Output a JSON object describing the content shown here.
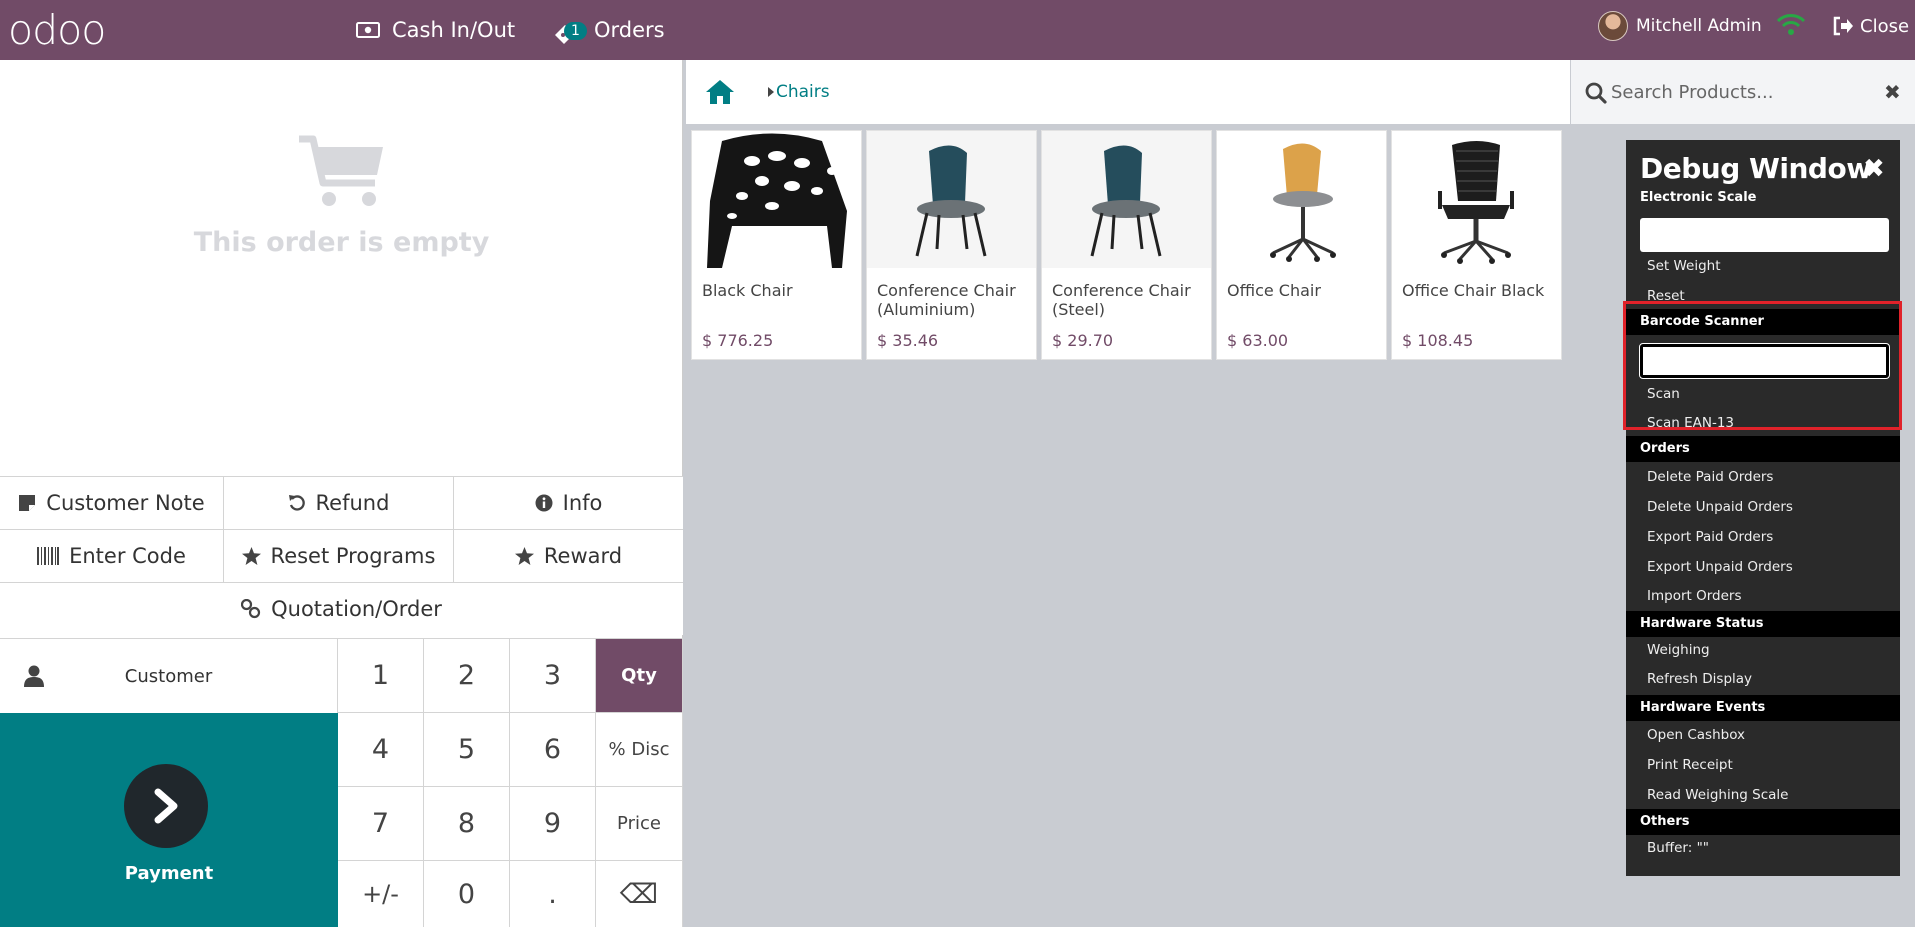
{
  "header": {
    "logo": "odoo",
    "cash_label": "Cash In/Out",
    "orders_label": "Orders",
    "orders_badge": "1",
    "user_name": "Mitchell Admin",
    "close_label": "Close"
  },
  "order": {
    "empty_text": "This order is empty"
  },
  "controls": {
    "customer_note": "Customer Note",
    "refund": "Refund",
    "info": "Info",
    "enter_code": "Enter Code",
    "reset_programs": "Reset Programs",
    "reward": "Reward",
    "quotation": "Quotation/Order"
  },
  "numpad": {
    "customer": "Customer",
    "payment": "Payment",
    "keys": [
      "1",
      "2",
      "3",
      "Qty",
      "4",
      "5",
      "6",
      "% Disc",
      "7",
      "8",
      "9",
      "Price",
      "+/-",
      "0",
      ".",
      "⌫"
    ]
  },
  "breadcrumb": {
    "category": "Chairs"
  },
  "search": {
    "placeholder": "Search Products..."
  },
  "products": [
    {
      "name": "Black Chair",
      "price": "$ 776.25"
    },
    {
      "name": "Conference Chair (Aluminium)",
      "price": "$ 35.46"
    },
    {
      "name": "Conference Chair (Steel)",
      "price": "$ 29.70"
    },
    {
      "name": "Office Chair",
      "price": "$ 63.00"
    },
    {
      "name": "Office Chair Black",
      "price": "$ 108.45"
    }
  ],
  "debug": {
    "title": "Debug Window",
    "scale_header": "Electronic Scale",
    "set_weight": "Set Weight",
    "reset": "Reset",
    "barcode_header": "Barcode Scanner",
    "scan": "Scan",
    "scan_ean": "Scan EAN-13",
    "orders_header": "Orders",
    "delete_paid": "Delete Paid Orders",
    "delete_unpaid": "Delete Unpaid Orders",
    "export_paid": "Export Paid Orders",
    "export_unpaid": "Export Unpaid Orders",
    "import_orders": "Import Orders",
    "hw_status_header": "Hardware Status",
    "weighing": "Weighing",
    "refresh": "Refresh Display",
    "hw_events_header": "Hardware Events",
    "open_cashbox": "Open Cashbox",
    "print_receipt": "Print Receipt",
    "read_scale": "Read Weighing Scale",
    "others_header": "Others",
    "buffer": "Buffer: \"\""
  },
  "colors": {
    "brand": "#714b67",
    "teal": "#017e84",
    "highlight": "#e0222a"
  }
}
